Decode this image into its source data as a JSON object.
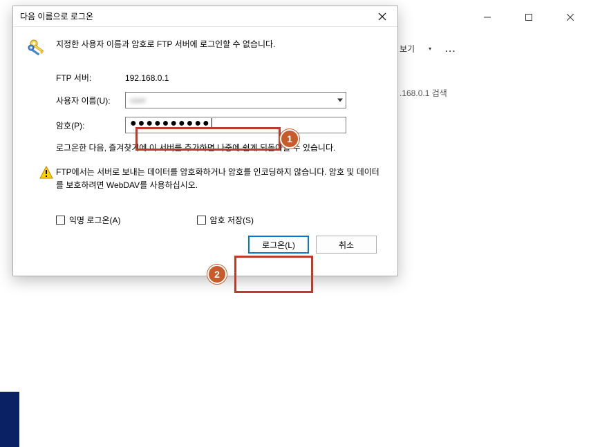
{
  "dialog": {
    "title": "다음 이름으로 로그온",
    "message": "지정한 사용자 이름과 암호로 FTP 서버에 로그인할 수 없습니다.",
    "ftp_server_label": "FTP 서버:",
    "ftp_server_value": "192.168.0.1",
    "username_label": "사용자 이름(U):",
    "username_value": "user",
    "password_label": "암호(P):",
    "password_value": "●●●●●●●●●●",
    "info_text": "로그온한 다음, 즐겨찾기에 이 서버를 추가하면 나중에 쉽게 되돌아올 수 있습니다.",
    "warning_text": "FTP에서는 서버로 보내는 데이터를 암호화하거나 암호를 인코딩하지 않습니다. 암호 및 데이터를 보호하려면 WebDAV를 사용하십시오.",
    "anonymous_label": "익명 로그온(A)",
    "save_password_label": "암호 저장(S)",
    "login_button": "로그온(L)",
    "cancel_button": "취소"
  },
  "background": {
    "view_label": "보기",
    "search_hint": ".168.0.1 검색",
    "ellipsis": "..."
  },
  "annotations": {
    "badge1": "1",
    "badge2": "2"
  }
}
